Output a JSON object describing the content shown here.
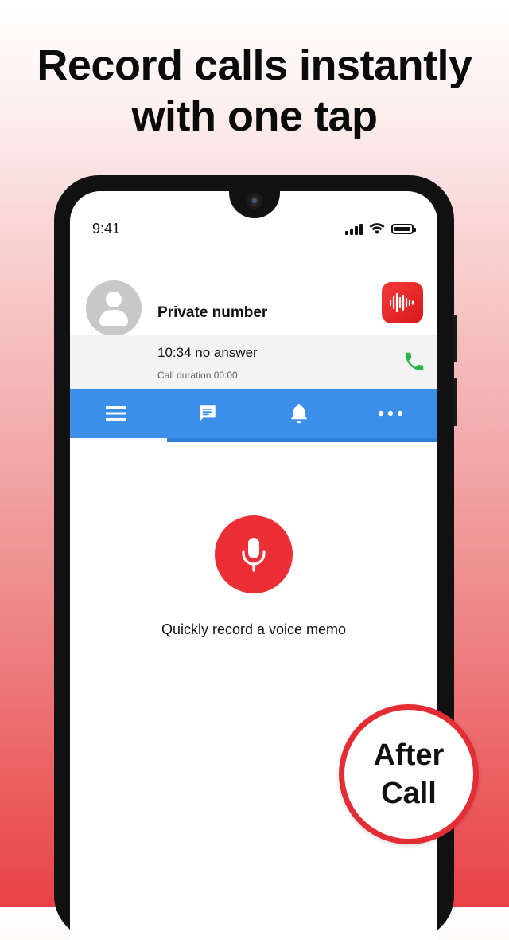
{
  "headline": {
    "line1": "Record calls instantly",
    "line2": "with one tap"
  },
  "status_bar": {
    "time": "9:41",
    "icons": [
      "signal-icon",
      "wifi-icon",
      "battery-icon"
    ]
  },
  "caller": {
    "name": "Private number",
    "status": "10:34 no answer",
    "duration": "Call duration 00:00",
    "avatar_icon": "person-icon",
    "app_icon": "sound-wave-icon",
    "call_icon": "phone-icon"
  },
  "tabs": [
    {
      "name": "menu",
      "icon": "menu-icon",
      "selected": true
    },
    {
      "name": "messages",
      "icon": "message-icon",
      "selected": false
    },
    {
      "name": "notifications",
      "icon": "bell-icon",
      "selected": false
    },
    {
      "name": "more",
      "icon": "more-icon",
      "selected": false
    }
  ],
  "record": {
    "label": "Quickly record a voice memo",
    "icon": "microphone-icon"
  },
  "badge": {
    "line1": "After",
    "line2": "Call"
  },
  "colors": {
    "accent_red": "#ec2f36",
    "tab_blue": "#3c8fe8",
    "call_green": "#2db34a"
  }
}
